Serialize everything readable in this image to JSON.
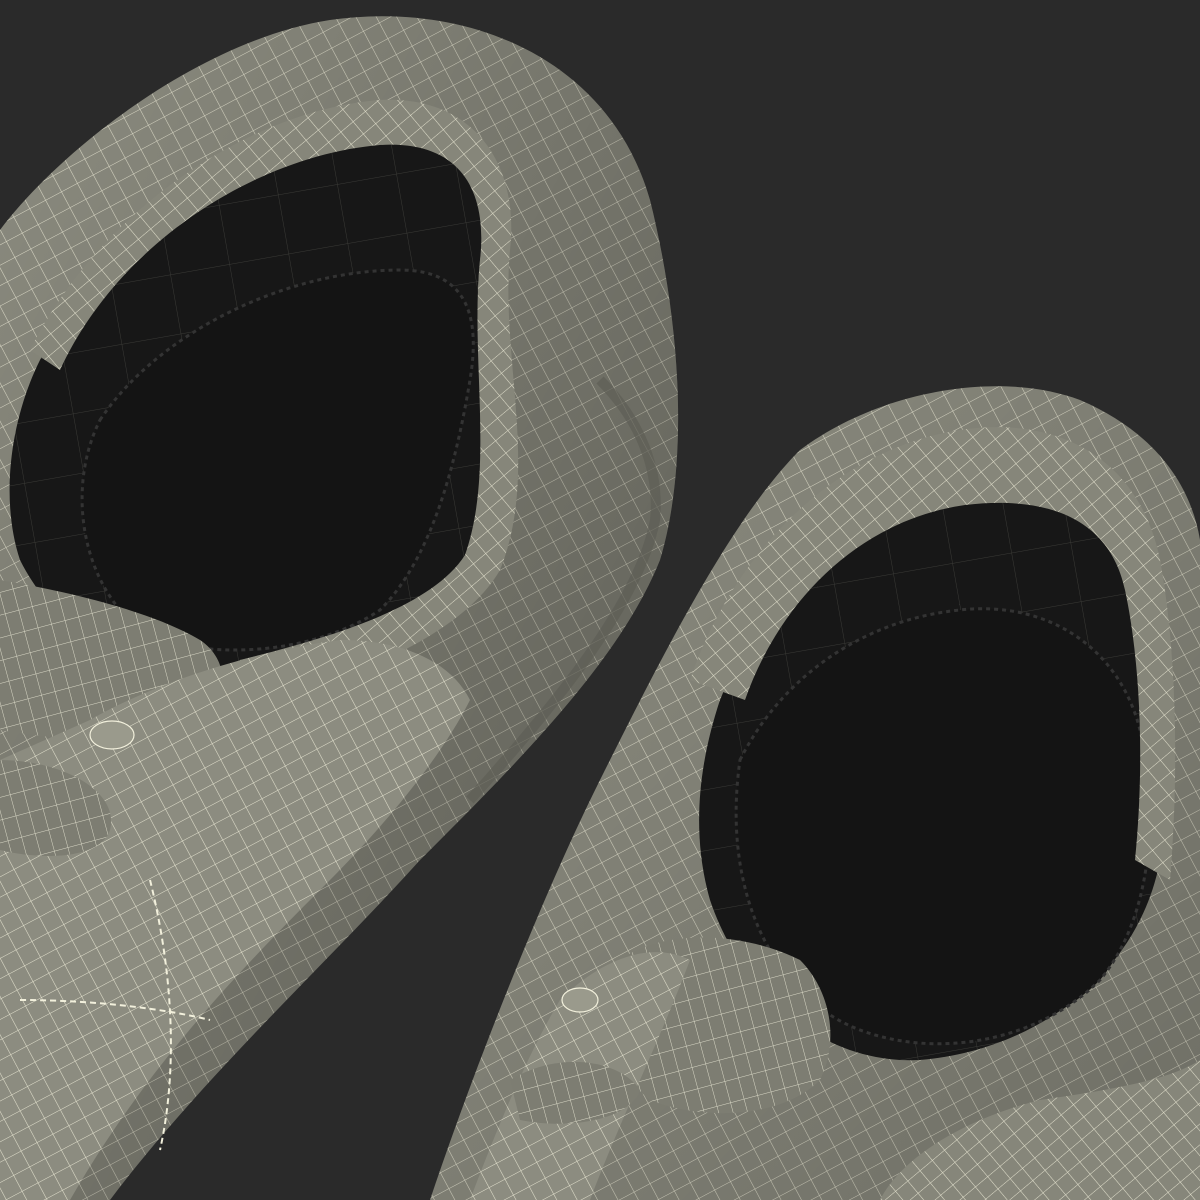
{
  "scene": {
    "background_color": "#2a2a2a",
    "mesh_fill_color": "#8c8c80",
    "mesh_shadow_color": "#5e5e56",
    "wire_color": "#f2f0dc",
    "interior_color": "#1c1c1c",
    "insole_color": "#161616"
  },
  "subjects": [
    {
      "name": "left-sneaker",
      "kind": "3d-wireframe-shoe"
    },
    {
      "name": "right-sneaker",
      "kind": "3d-wireframe-shoe"
    }
  ]
}
